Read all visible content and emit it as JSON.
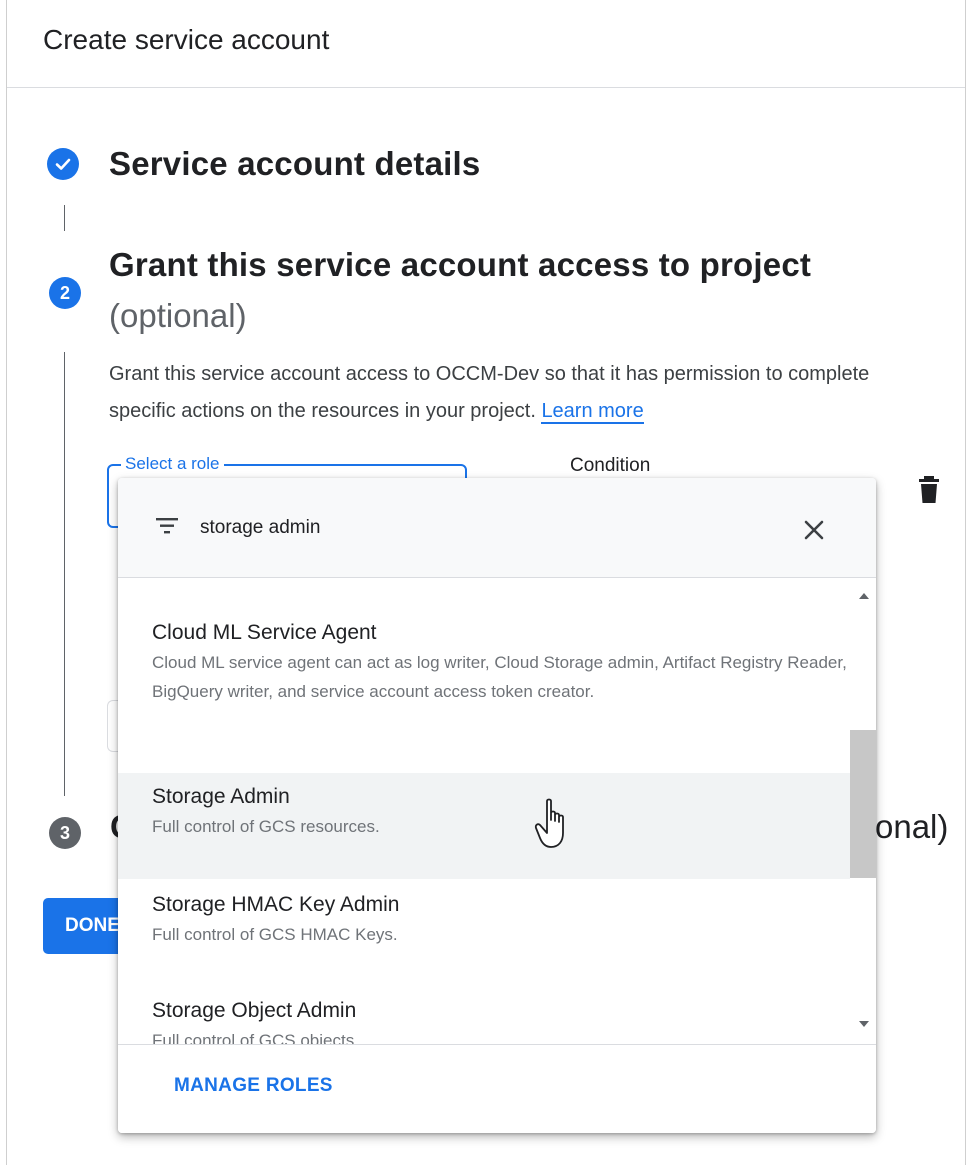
{
  "header": {
    "title": "Create service account"
  },
  "steps": [
    {
      "number": "",
      "title": "Service account details",
      "status": "completed"
    },
    {
      "number": "2",
      "title": "Grant this service account access to project",
      "optional": "(optional)",
      "status": "active"
    },
    {
      "number": "3",
      "title_visible_left": "G",
      "title_visible_right": "onal)",
      "status": "pending"
    }
  ],
  "step2": {
    "description_prefix": "Grant this service account access to OCCM-Dev so that it has permission to complete specific actions on the resources in your project. ",
    "learn_more": "Learn more",
    "role_select_label": "Select a role",
    "condition_label": "Condition"
  },
  "done_button": "DONE",
  "dropdown": {
    "filter_value": "storage admin",
    "items": [
      {
        "title": "Cloud ML Service Agent",
        "description": "Cloud ML service agent can act as log writer, Cloud Storage admin, Artifact Registry Reader, BigQuery writer, and service account access token creator."
      },
      {
        "title": "Storage Admin",
        "description": "Full control of GCS resources."
      },
      {
        "title": "Storage HMAC Key Admin",
        "description": "Full control of GCS HMAC Keys."
      },
      {
        "title": "Storage Object Admin",
        "description": "Full control of GCS objects."
      }
    ],
    "manage_roles": "MANAGE ROLES"
  },
  "colors": {
    "accent": "#1a73e8",
    "pending": "#5f6368",
    "hover_row": "#f1f3f4"
  },
  "icons": [
    "check-icon",
    "filter-icon",
    "close-icon",
    "delete-icon",
    "hand-cursor-icon"
  ]
}
